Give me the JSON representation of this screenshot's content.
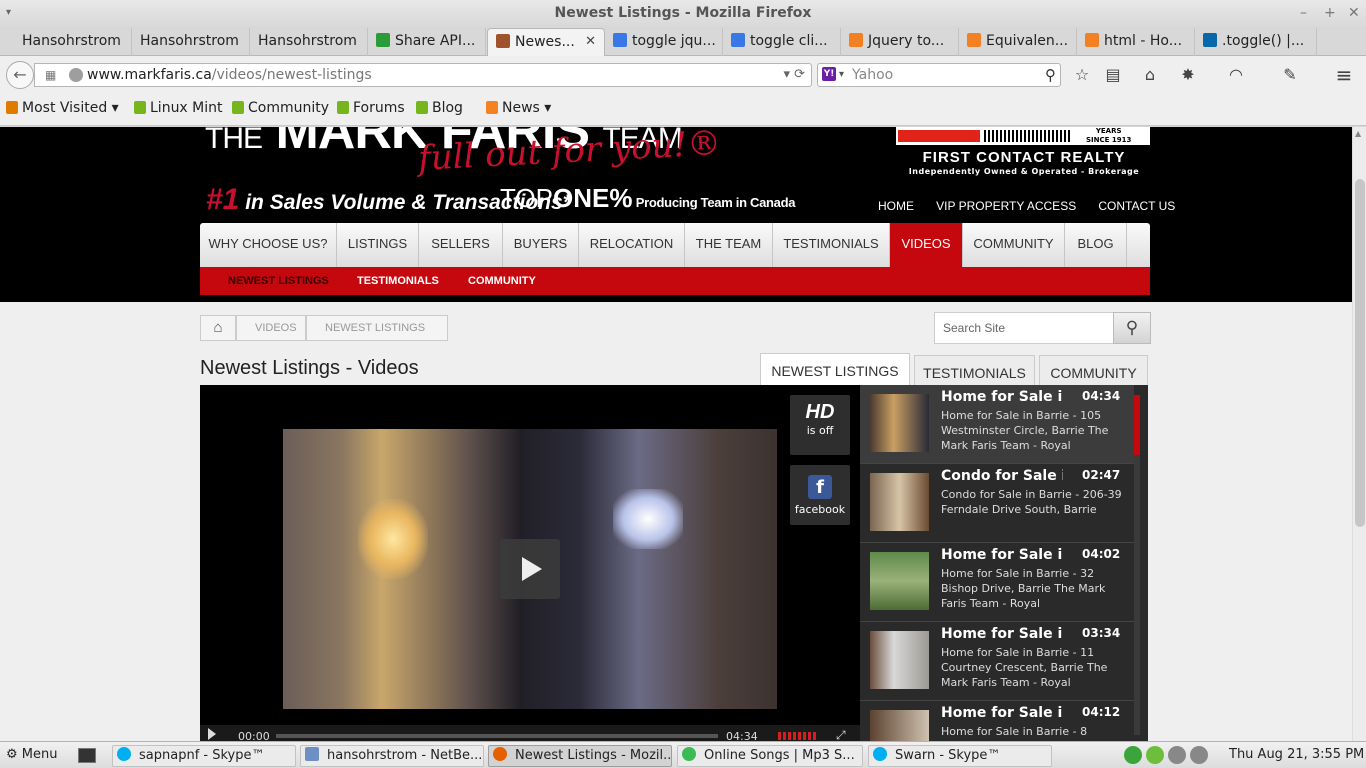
{
  "window": {
    "title": "Newest Listings - Mozilla Firefox",
    "menu_arrow": "▾",
    "ctrl_minimize": "–",
    "ctrl_maximize": "+",
    "ctrl_close": "✕"
  },
  "tabs": [
    {
      "label": "Hansohrstrom",
      "icon": "page-icon",
      "color": "#d8d8d8"
    },
    {
      "label": "Hansohrstrom",
      "icon": "page-icon",
      "color": "#d8d8d8"
    },
    {
      "label": "Hansohrstrom",
      "icon": "page-icon",
      "color": "#d8d8d8"
    },
    {
      "label": "Share API...",
      "icon": "share-api-icon",
      "color": "#2a9d3a"
    },
    {
      "label": "Newes...",
      "icon": "markfaris-favicon",
      "color": "#a0522d",
      "active": true
    },
    {
      "label": "toggle jqu...",
      "icon": "google-icon",
      "color": "#3b78e7"
    },
    {
      "label": "toggle cli...",
      "icon": "google-icon",
      "color": "#3b78e7"
    },
    {
      "label": "Jquery to...",
      "icon": "stackoverflow-icon",
      "color": "#f48024"
    },
    {
      "label": "Equivalen...",
      "icon": "stackoverflow-icon",
      "color": "#f48024"
    },
    {
      "label": "html - Ho...",
      "icon": "stackoverflow-icon",
      "color": "#f48024"
    },
    {
      "label": ".toggle() |...",
      "icon": "jquery-icon",
      "color": "#0868ac"
    }
  ],
  "tab_close": "✕",
  "new_tab": "+",
  "nav": {
    "back": "←",
    "url_domain": "www.markfaris.ca",
    "url_path": "/videos/newest-listings",
    "url_buttons": "▾ ⟳",
    "search_engine": "Yahoo",
    "search_icon_text": "Y!",
    "search_drop": "▾",
    "search_glass": "⚲",
    "icons": {
      "bookmark_star": "☆",
      "reader": "▤",
      "home": "⌂",
      "addon1": "✸",
      "addon2": "◠",
      "addon3": "✎",
      "menu": "≡"
    }
  },
  "bookmarks": [
    {
      "label": "Most Visited ▾",
      "color": "#e07b00"
    },
    {
      "label": "Linux Mint",
      "color": "#77b51d"
    },
    {
      "label": "Community",
      "color": "#77b51d"
    },
    {
      "label": "Forums",
      "color": "#77b51d"
    },
    {
      "label": "Blog",
      "color": "#77b51d"
    },
    {
      "label": "News ▾",
      "color": "#f58220"
    }
  ],
  "site": {
    "logo_prefix": "THE",
    "logo_main": "MARK FARIS",
    "logo_suffix": "TEAM",
    "tagline": "full out for you!®",
    "sales_num": "#1",
    "sales_text": " in Sales Volume & Transactions*",
    "topone_a": "TOP",
    "topone_b": "ONE%",
    "topone_c": " Producing Team in Canada",
    "brokerage_name": "FIRST CONTACT REALTY",
    "brokerage_sub": "Independently Owned & Operated - Brokerage",
    "brokerage_since": "YEARS\nSINCE 1913",
    "top_links": [
      "HOME",
      "VIP PROPERTY ACCESS",
      "CONTACT US"
    ],
    "main_nav": [
      "WHY CHOOSE US?",
      "LISTINGS",
      "SELLERS",
      "BUYERS",
      "RELOCATION",
      "THE TEAM",
      "TESTIMONIALS",
      "VIDEOS",
      "COMMUNITY",
      "BLOG"
    ],
    "main_nav_active": "VIDEOS",
    "sub_nav": [
      "NEWEST LISTINGS",
      "TESTIMONIALS",
      "COMMUNITY"
    ],
    "breadcrumbs": [
      "VIDEOS",
      "NEWEST LISTINGS"
    ],
    "home_icon": "⌂",
    "search_placeholder": "Search Site",
    "search_icon": "⚲",
    "page_heading": "Newest Listings - Videos",
    "video_tabs": [
      "NEWEST LISTINGS",
      "TESTIMONIALS",
      "COMMUNITY"
    ],
    "player": {
      "hd_label": "HD",
      "hd_state": "is off",
      "facebook_label": "facebook",
      "facebook_glyph": "f",
      "time_current": "00:00",
      "time_total": "04:34",
      "fullscreen": "⤢"
    },
    "playlist": [
      {
        "title": "Home for Sale in",
        "duration": "04:34",
        "desc": "Home for Sale in Barrie - 105 Westminster Circle, Barrie The Mark Faris Team - Royal"
      },
      {
        "title": "Condo for Sale in",
        "duration": "02:47",
        "desc": "Condo for Sale in Barrie - 206-39 Ferndale Drive South, Barrie"
      },
      {
        "title": "Home for Sale in",
        "duration": "04:02",
        "desc": "Home for Sale in Barrie - 32 Bishop Drive, Barrie The Mark Faris Team - Royal"
      },
      {
        "title": "Home for Sale in",
        "duration": "03:34",
        "desc": "Home for Sale in Barrie - 11 Courtney Crescent, Barrie The Mark Faris Team - Royal"
      },
      {
        "title": "Home for Sale in",
        "duration": "04:12",
        "desc": "Home for Sale in Barrie - 8"
      }
    ]
  },
  "taskbar": {
    "menu": "⚙ Menu",
    "windows": [
      {
        "label": "sapnapnf - Skype™",
        "icon": "skype-icon",
        "color": "#00aff0"
      },
      {
        "label": "hansohrstrom - NetBe...",
        "icon": "netbeans-icon",
        "color": "#6d8fc4"
      },
      {
        "label": "Newest Listings - Mozil...",
        "icon": "firefox-icon",
        "color": "#e66000",
        "active": true
      },
      {
        "label": "Online Songs | Mp3 S...",
        "icon": "chrome-icon",
        "color": "#3cba54"
      },
      {
        "label": "Swarn - Skype™",
        "icon": "skype-icon",
        "color": "#00aff0"
      }
    ],
    "tray_colors": [
      "#3ba53b",
      "#6cbf3c",
      "#888888",
      "#888888"
    ],
    "clock": "Thu Aug 21,  3:55 PM"
  }
}
